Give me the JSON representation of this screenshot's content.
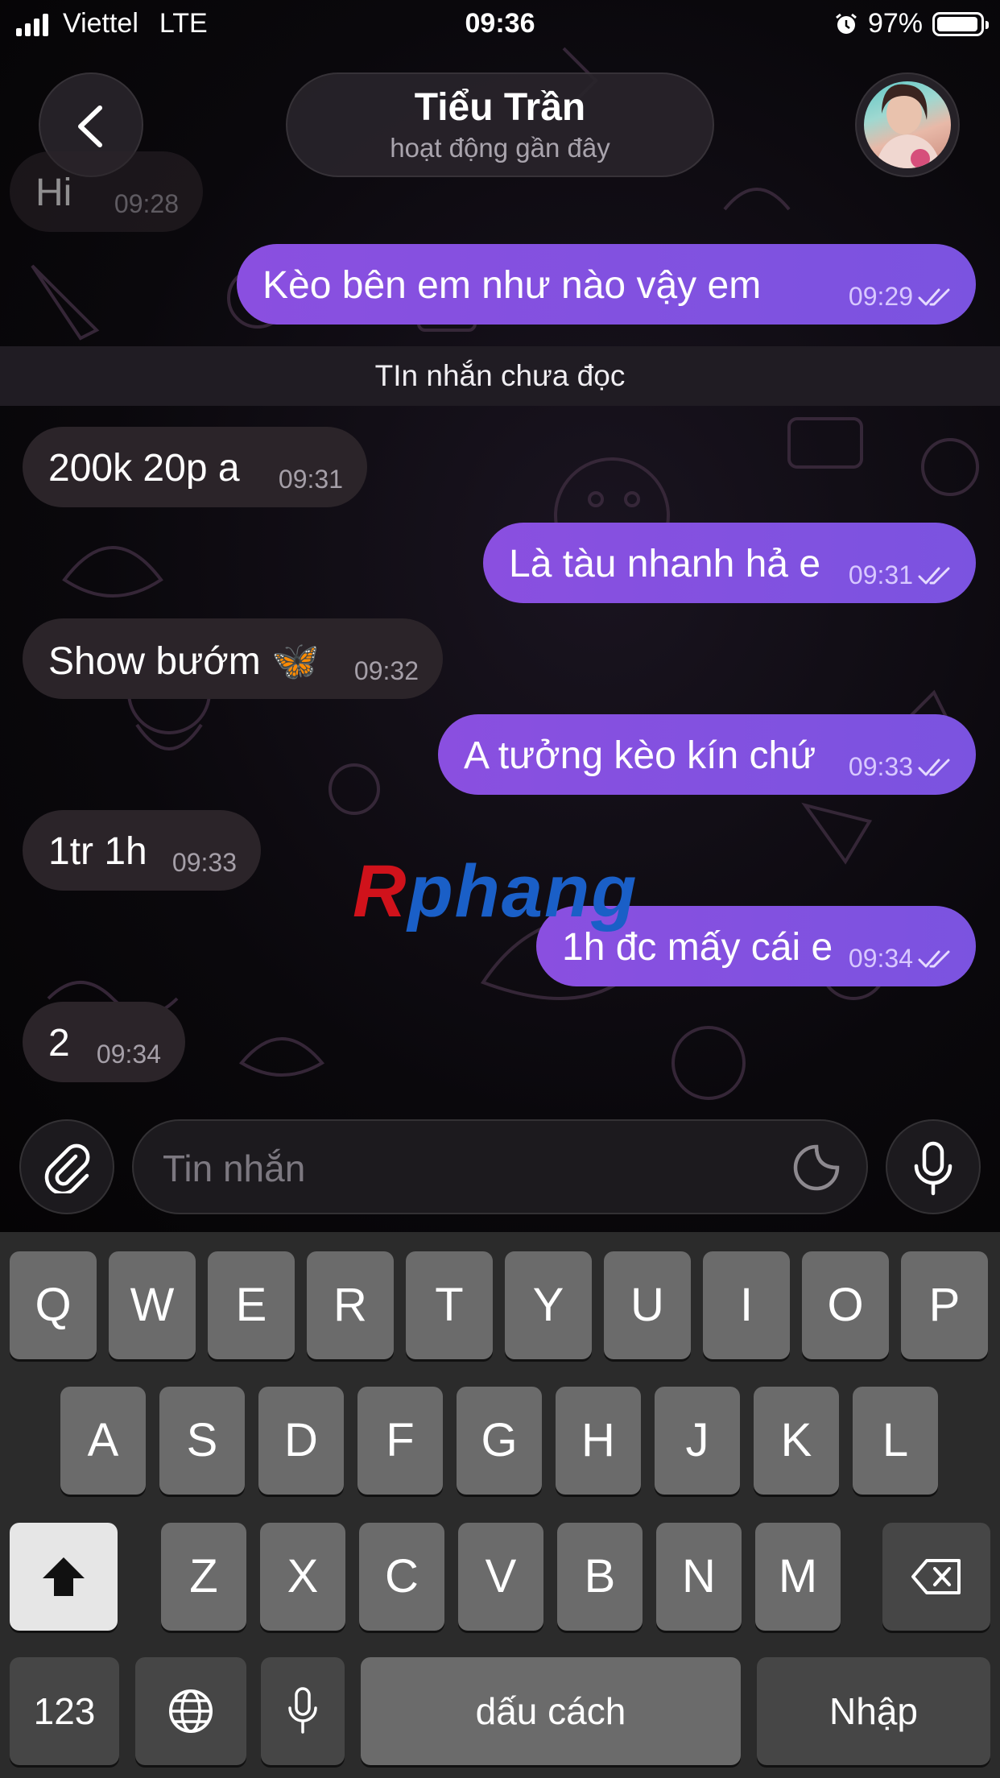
{
  "status_bar": {
    "carrier": "Viettel",
    "network": "LTE",
    "time": "09:36",
    "battery": "97%",
    "battery_level": 0.97
  },
  "header": {
    "contact_name": "Tiểu Trần",
    "contact_status": "hoạt động gần đây"
  },
  "unread_separator": "TIn nhắn chưa đọc",
  "messages": [
    {
      "dir": "in",
      "text": "Hi",
      "time": "09:28"
    },
    {
      "dir": "out",
      "text": "Kèo bên em như nào vậy em",
      "time": "09:29",
      "read": true
    },
    {
      "dir": "in",
      "text": "200k 20p a",
      "time": "09:31"
    },
    {
      "dir": "out",
      "text": "Là tàu nhanh hả e",
      "time": "09:31",
      "read": true
    },
    {
      "dir": "in",
      "text": "Show bướm 🦋",
      "time": "09:32"
    },
    {
      "dir": "out",
      "text": "A tưởng kèo kín chứ",
      "time": "09:33",
      "read": true
    },
    {
      "dir": "in",
      "text": "1tr 1h",
      "time": "09:33"
    },
    {
      "dir": "out",
      "text": "1h đc mấy cái e",
      "time": "09:34",
      "read": true
    },
    {
      "dir": "in",
      "text": "2",
      "time": "09:34"
    }
  ],
  "watermark": {
    "first": "R",
    "rest": "phang"
  },
  "composer": {
    "placeholder": "Tin nhắn"
  },
  "keyboard": {
    "row1": [
      "Q",
      "W",
      "E",
      "R",
      "T",
      "Y",
      "U",
      "I",
      "O",
      "P"
    ],
    "row2": [
      "A",
      "S",
      "D",
      "F",
      "G",
      "H",
      "J",
      "K",
      "L"
    ],
    "row3": [
      "Z",
      "X",
      "C",
      "V",
      "B",
      "N",
      "M"
    ],
    "numbers": "123",
    "space": "dấu cách",
    "return": "Nhập"
  },
  "colors": {
    "outgoing": "#8a4fe0",
    "incoming": "#2b2429",
    "keyboard_bg": "#2b2b2b",
    "key": "#6b6b6b"
  }
}
